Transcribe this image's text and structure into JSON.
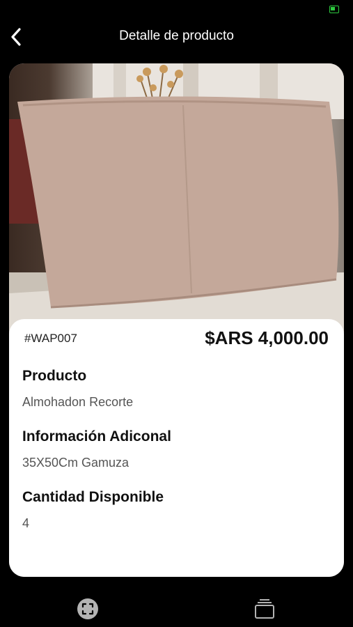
{
  "header": {
    "title": "Detalle de producto",
    "back_icon": "chevron-left-icon"
  },
  "product": {
    "sku": "#WAP007",
    "price": "$ARS 4,000.00",
    "fields": [
      {
        "label": "Producto",
        "value": "Almohadon Recorte"
      },
      {
        "label": "Información Adiconal",
        "value": "35X50Cm Gamuza"
      },
      {
        "label": "Cantidad Disponible",
        "value": "4"
      }
    ]
  },
  "tab_bar": {
    "items": [
      {
        "icon": "scan-icon"
      },
      {
        "icon": "stacked-cards-icon"
      }
    ]
  },
  "colors": {
    "background": "#000000",
    "card": "#ffffff",
    "battery": "#2ecc40",
    "tab_icon": "#b3b3b3"
  }
}
